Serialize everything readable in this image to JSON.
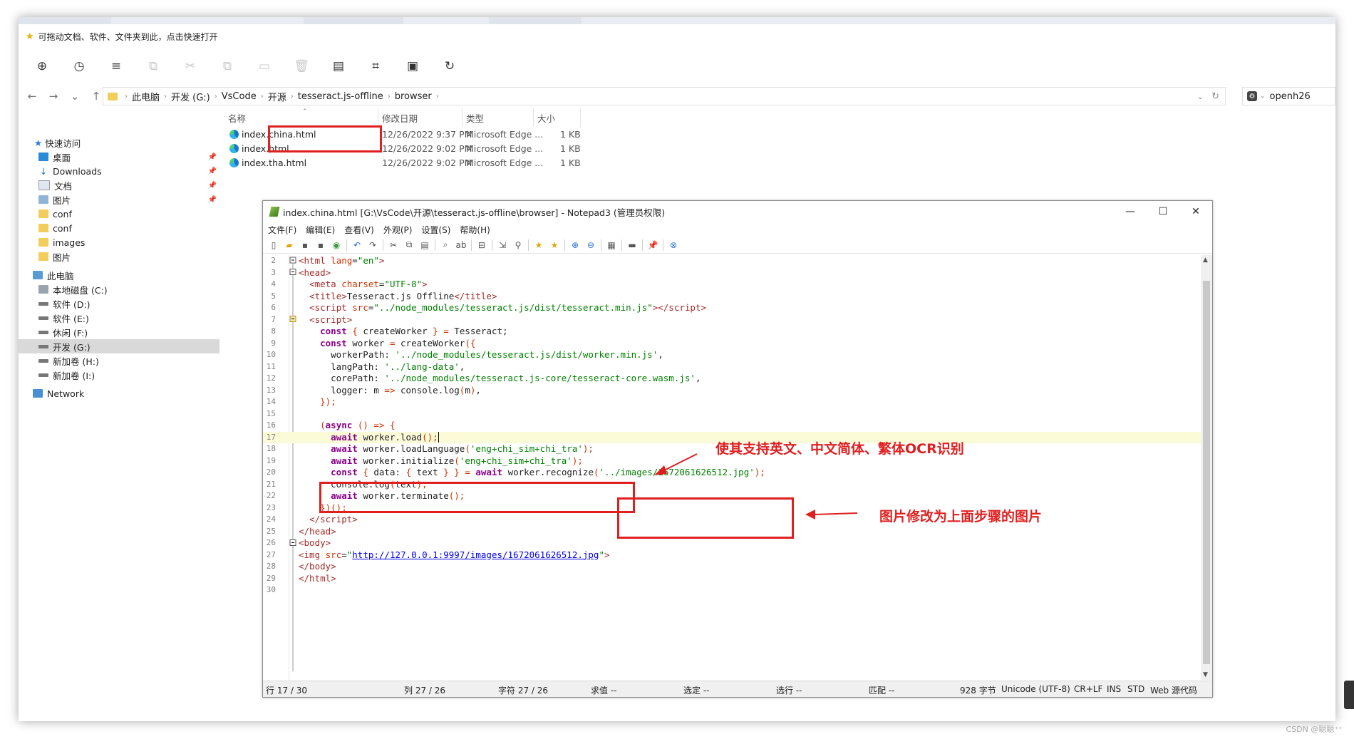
{
  "bookmarks_bar": {
    "text": "可拖动文档、软件、文件夹到此，点击快速打开"
  },
  "address": {
    "crumbs": [
      "此电脑",
      "开发 (G:)",
      "VsCode",
      "开源",
      "tesseract.js-offline",
      "browser"
    ],
    "search_text": "openh26"
  },
  "nav_pane": {
    "quick_access": "快速访问",
    "items": [
      "桌面",
      "Downloads",
      "文档",
      "图片",
      "conf",
      "conf",
      "images",
      "图片"
    ],
    "this_pc": "此电脑",
    "drives": [
      "本地磁盘 (C:)",
      "软件 (D:)",
      "软件 (E:)",
      "休闲 (F:)",
      "开发 (G:)",
      "新加卷 (H:)",
      "新加卷 (I:)"
    ],
    "network": "Network"
  },
  "file_list": {
    "headers": {
      "name": "名称",
      "date": "修改日期",
      "type": "类型",
      "size": "大小"
    },
    "rows": [
      {
        "name": "index.china.html",
        "date": "12/26/2022 9:37 PM",
        "type": "Microsoft Edge ...",
        "size": "1 KB"
      },
      {
        "name": "index.html",
        "date": "12/26/2022 9:02 PM",
        "type": "Microsoft Edge ...",
        "size": "1 KB"
      },
      {
        "name": "index.tha.html",
        "date": "12/26/2022 9:02 PM",
        "type": "Microsoft Edge ...",
        "size": "1 KB"
      }
    ]
  },
  "notepad": {
    "title": "index.china.html [G:\\VsCode\\开源\\tesseract.js-offline\\browser] - Notepad3  (管理员权限)",
    "menu": [
      "文件(F)",
      "编辑(E)",
      "查看(V)",
      "外观(P)",
      "设置(S)",
      "帮助(H)"
    ],
    "status": {
      "line": "行 17 / 30",
      "col": "列 27 / 26",
      "char": "字符 27 / 26",
      "sum": "求值 --",
      "select": "选定 --",
      "sel_lines": "选行 --",
      "match": "匹配 --",
      "bytes": "928 字节",
      "encoding": "Unicode (UTF-8)",
      "eol": "CR+LF",
      "ins": "INS",
      "std": "STD",
      "lexer": "Web 源代码"
    }
  },
  "code": {
    "numbers": [
      "2",
      "3",
      "4",
      "5",
      "6",
      "7",
      "8",
      "9",
      "10",
      "11",
      "12",
      "13",
      "14",
      "15",
      "16",
      "17",
      "18",
      "19",
      "20",
      "21",
      "22",
      "23",
      "24",
      "25",
      "26",
      "27",
      "28",
      "29",
      "30"
    ]
  },
  "annotations": {
    "lang_note": "使其支持英文、中文简体、繁体OCR识别",
    "image_note": "图片修改为上面步骤的图片"
  },
  "watermark": "CSDN @聪聪⁺⁺"
}
